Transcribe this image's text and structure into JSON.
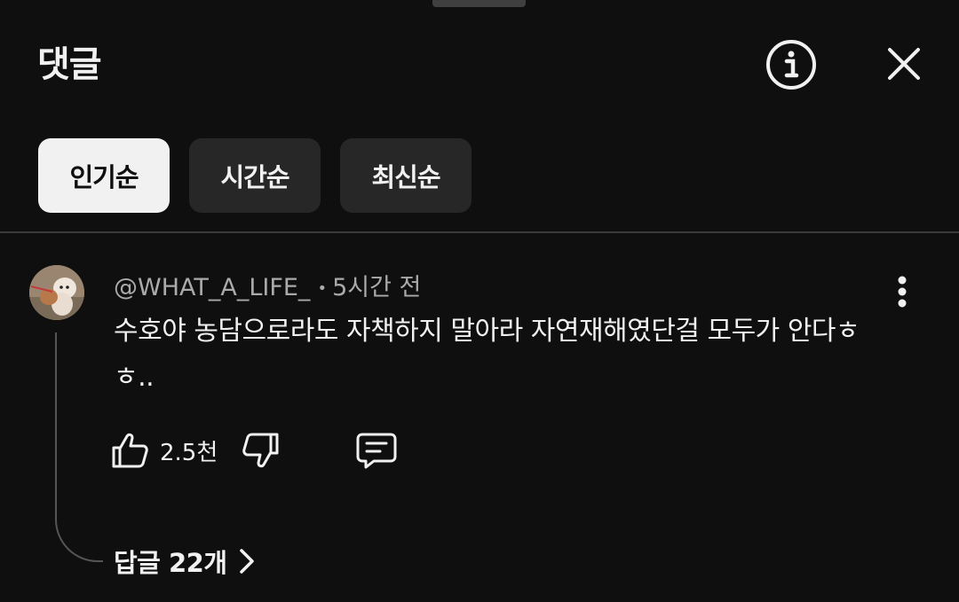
{
  "header": {
    "title": "댓글"
  },
  "sort_chips": [
    {
      "label": "인기순",
      "selected": true
    },
    {
      "label": "시간순",
      "selected": false
    },
    {
      "label": "최신순",
      "selected": false
    }
  ],
  "comment": {
    "author": "@WHAT_A_LIFE_",
    "separator": "•",
    "time": "5시간 전",
    "text": "수호야 농담으로라도 자책하지 말아라 자연재해였단걸 모두가 안다ㅎㅎ..",
    "like_count": "2.5천",
    "replies_label": "답글 22개"
  },
  "icons": {
    "info": "info-icon",
    "close": "close-icon",
    "more": "more-vert-icon",
    "like": "thumbs-up-icon",
    "dislike": "thumbs-down-icon",
    "reply": "comment-icon",
    "chevron": "chevron-right-icon"
  }
}
